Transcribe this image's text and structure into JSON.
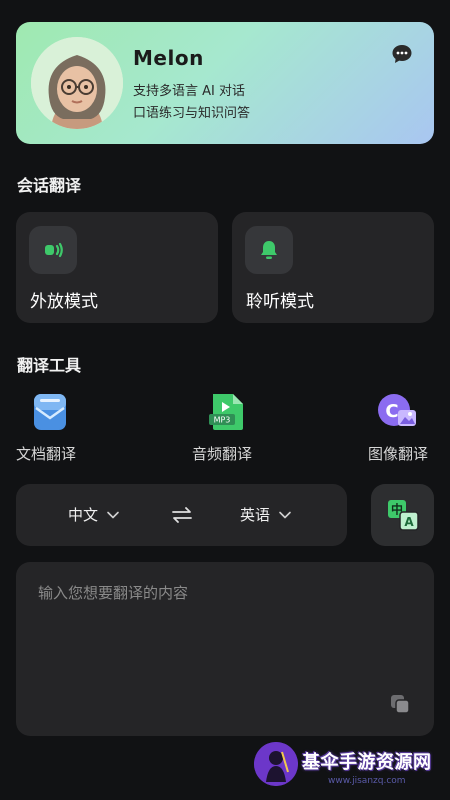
{
  "profile": {
    "name": "Melon",
    "line1": "支持多语言 AI 对话",
    "line2": "口语练习与知识问答"
  },
  "conversation": {
    "title": "会话翻译",
    "modes": [
      {
        "label": "外放模式",
        "icon": "speaker-icon"
      },
      {
        "label": "聆听模式",
        "icon": "bell-icon"
      }
    ]
  },
  "tools": {
    "title": "翻译工具",
    "items": [
      {
        "label": "文档翻译",
        "icon": "document-mail-icon"
      },
      {
        "label": "音频翻译",
        "icon": "mp3-file-icon"
      },
      {
        "label": "图像翻译",
        "icon": "image-icon"
      }
    ]
  },
  "languages": {
    "source": "中文",
    "target": "英语"
  },
  "translate_button": {
    "top_glyph": "中",
    "bottom_glyph": "A"
  },
  "input": {
    "placeholder": "输入您想要翻译的内容",
    "value": ""
  },
  "watermark": {
    "text": "基伞手游资源网",
    "url": "www.jisanzq.com"
  },
  "colors": {
    "accent_green": "#3ec96a",
    "card_bg": "#252527",
    "page_bg": "#111214",
    "hero_gradient_start": "#9fe9b0",
    "hero_gradient_end": "#a9c6f1"
  }
}
